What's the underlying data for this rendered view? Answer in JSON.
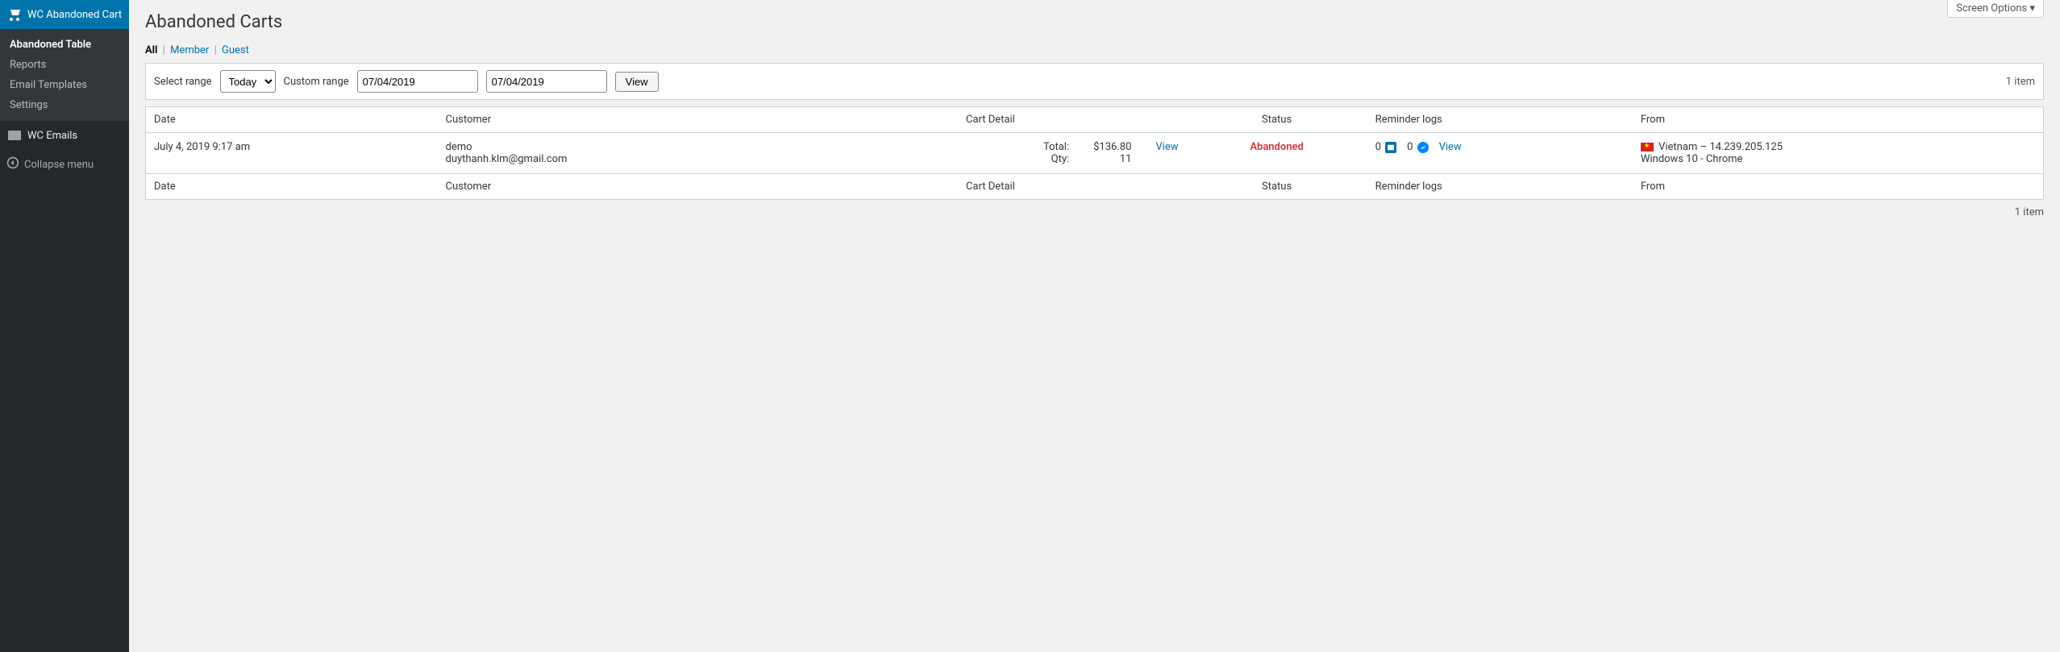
{
  "sidebar": {
    "items": [
      {
        "label": "WC Abandoned Cart",
        "icon": "cart-icon",
        "active": true,
        "sub": [
          {
            "label": "Abandoned Table",
            "current": true
          },
          {
            "label": "Reports"
          },
          {
            "label": "Email Templates"
          },
          {
            "label": "Settings"
          }
        ]
      },
      {
        "label": "WC Emails",
        "icon": "mail-icon"
      }
    ],
    "collapse_label": "Collapse menu"
  },
  "screen_options_label": "Screen Options ▾",
  "page_title": "Abandoned Carts",
  "filters": {
    "all": "All",
    "member": "Member",
    "guest": "Guest"
  },
  "toolbar": {
    "select_range_label": "Select range",
    "select_range_value": "Today",
    "custom_range_label": "Custom range",
    "date_from": "07/04/2019",
    "date_to": "07/04/2019",
    "view_label": "View",
    "item_count": "1 item"
  },
  "table": {
    "headers": {
      "date": "Date",
      "customer": "Customer",
      "cart_detail": "Cart Detail",
      "status": "Status",
      "reminder_logs": "Reminder logs",
      "from": "From"
    },
    "rows": [
      {
        "date": "July 4, 2019 9:17 am",
        "customer_name": "demo",
        "customer_email": "duythanh.klm@gmail.com",
        "total_label": "Total:",
        "total_value": "$136.80",
        "qty_label": "Qty:",
        "qty_value": "11",
        "detail_view": "View",
        "status": "Abandoned",
        "mail_count": "0",
        "chat_count": "0",
        "logs_view": "View",
        "from_country": "Vietnam",
        "from_ip": "14.239.205.125",
        "from_system": "Windows 10 - Chrome"
      }
    ]
  },
  "footer_count": "1 item"
}
